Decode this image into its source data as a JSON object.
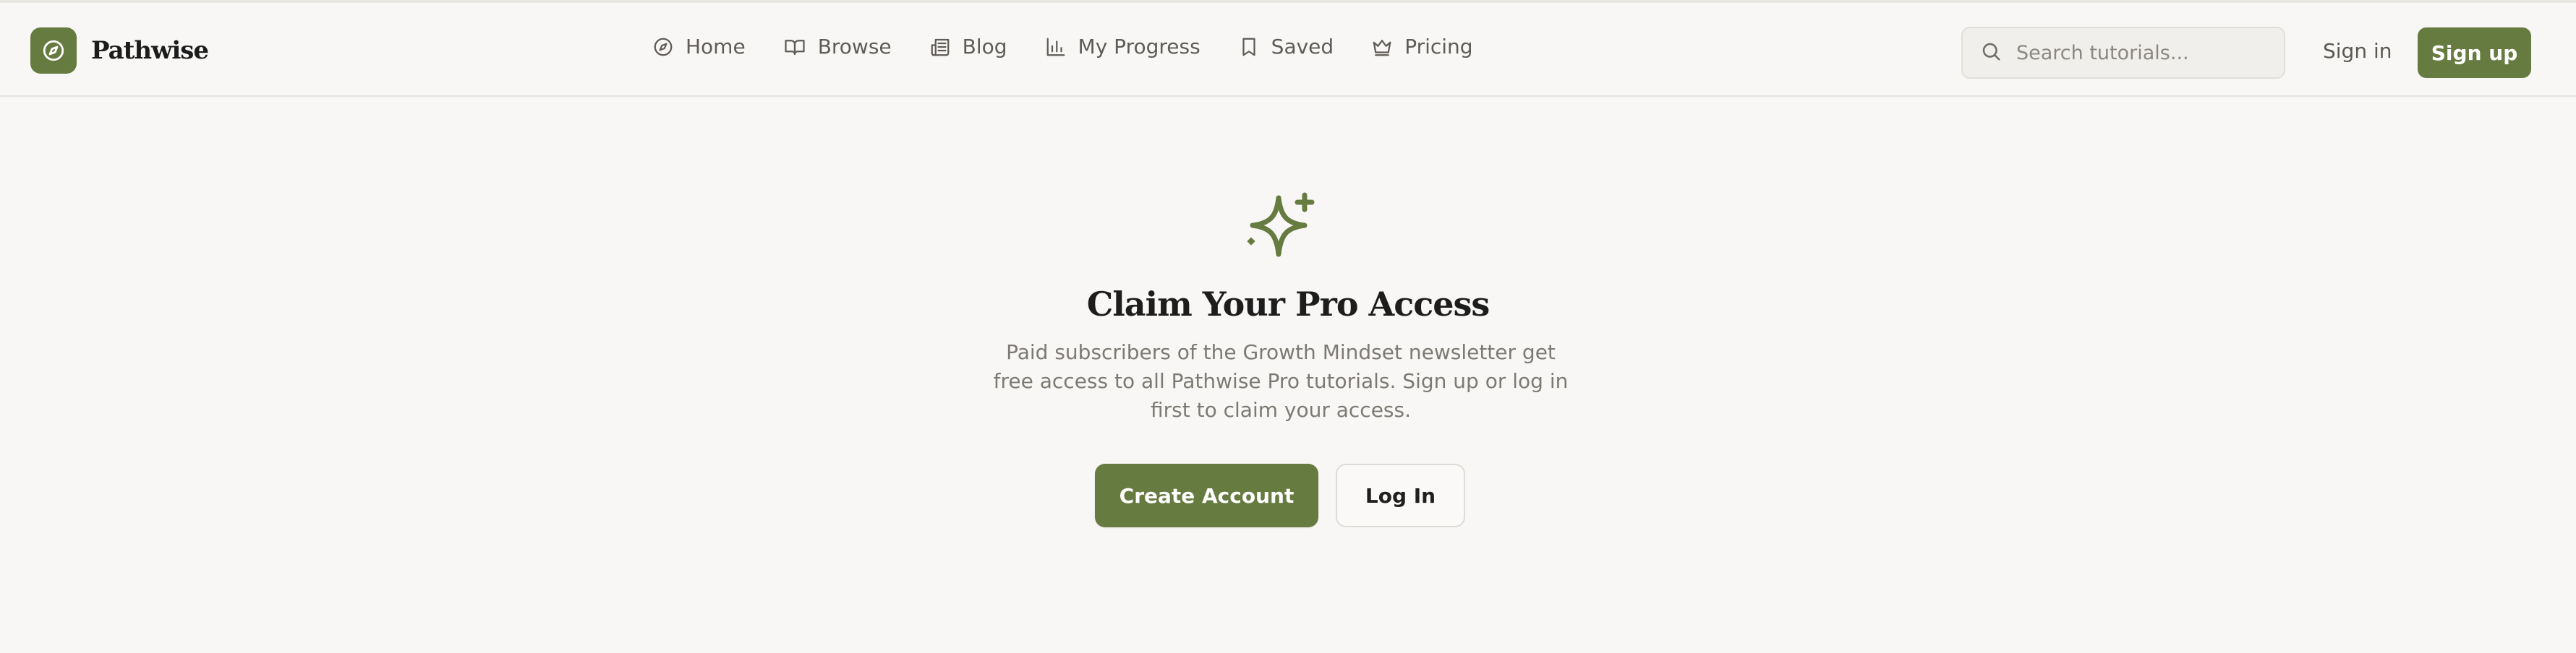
{
  "brand": {
    "name": "Pathwise",
    "icon": "compass-icon",
    "accent": "#667b40"
  },
  "nav": {
    "items": [
      {
        "label": "Home",
        "icon": "compass-icon"
      },
      {
        "label": "Browse",
        "icon": "book-open-icon"
      },
      {
        "label": "Blog",
        "icon": "newspaper-icon"
      },
      {
        "label": "My Progress",
        "icon": "bar-chart-icon"
      },
      {
        "label": "Saved",
        "icon": "bookmark-icon"
      },
      {
        "label": "Pricing",
        "icon": "crown-icon"
      }
    ]
  },
  "search": {
    "placeholder": "Search tutorials...",
    "value": "",
    "icon": "search-icon"
  },
  "auth": {
    "sign_in": "Sign in",
    "sign_up": "Sign up"
  },
  "hero": {
    "icon": "sparkle-icon",
    "title": "Claim Your Pro Access",
    "description": "Paid subscribers of the Growth Mindset newsletter get free access to all Pathwise Pro tutorials. Sign up or log in first to claim your access.",
    "primary_button": "Create Account",
    "secondary_button": "Log In"
  }
}
